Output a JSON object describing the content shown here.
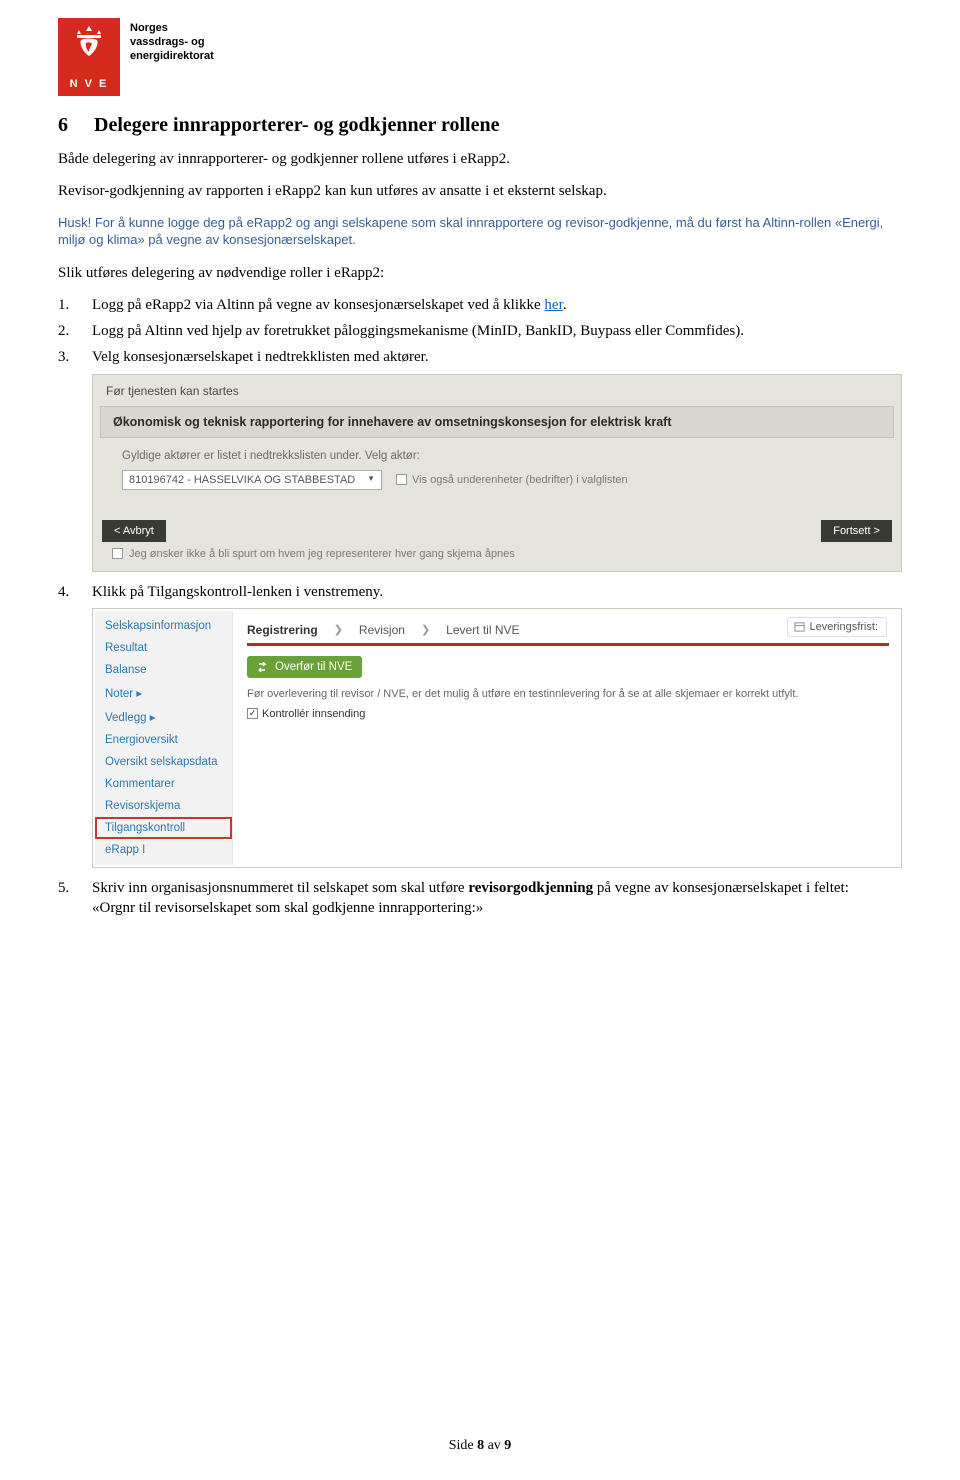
{
  "logo": {
    "org1": "Norges",
    "org2": "vassdrags- og",
    "org3": "energidirektorat",
    "abbr_letters": "N   V   E"
  },
  "section": {
    "number": "6",
    "title": "Delegere innrapporterer- og godkjenner rollene"
  },
  "intro1": "Både delegering av innrapporterer- og godkjenner rollene utføres i eRapp2.",
  "intro2": "Revisor-godkjenning av rapporten i eRapp2 kan kun utføres av ansatte i et eksternt selskap.",
  "husk_label": "Husk!",
  "husk_text": " For å kunne logge deg på eRapp2 og angi selskapene som skal innrapportere og revisor-godkjenne, må du først ha Altinn-rollen «Energi, miljø og klima» på vegne av konsesjonærselskapet.",
  "lead": "Slik utføres delegering av nødvendige roller i eRapp2:",
  "steps": {
    "s1a": "Logg på eRapp2 via Altinn på vegne av konsesjonærselskapet ved å klikke ",
    "s1_link": "her",
    "s1b": ".",
    "s2": "Logg på Altinn ved hjelp av foretrukket påloggingsmekanisme (MinID, BankID, Buypass eller Commfides).",
    "s3": "Velg konsesjonærselskapet i nedtrekklisten med aktører.",
    "s4": "Klikk på Tilgangskontroll-lenken i venstremeny.",
    "s5a": "Skriv inn organisasjonsnummeret til selskapet som skal utføre ",
    "s5b": "revisorgodkjenning",
    "s5c": " på vegne av konsesjonærselskapet i feltet:",
    "s5d": "«Orgnr til revisorselskapet som skal godkjenne innrapportering:»"
  },
  "altinn": {
    "preTitle": "Før tjenesten kan startes",
    "header": "Økonomisk og teknisk rapportering for innehavere av omsetningskonsesjon for elektrisk kraft",
    "listLabel": "Gyldige aktører er listet i nedtrekkslisten under. Velg aktør:",
    "selectValue": "810196742 - HASSELVIKA OG STABBESTAD",
    "showSub": "Vis også underenheter (bedrifter) i valglisten",
    "cancel": "< Avbryt",
    "continue": "Fortsett >",
    "dontAsk": "Jeg ønsker ikke å bli spurt om hvem jeg representerer hver gang skjema åpnes"
  },
  "erapp": {
    "menu": [
      "Selskapsinformasjon",
      "Resultat",
      "Balanse",
      "Noter ▸",
      "Vedlegg ▸",
      "Energioversikt",
      "Oversikt selskapsdata",
      "Kommentarer",
      "Revisorskjema",
      "Tilgangskontroll",
      "eRapp I"
    ],
    "crumbs": {
      "c1": "Registrering",
      "c2": "Revisjon",
      "c3": "Levert til NVE"
    },
    "deadline": "Leveringsfrist:",
    "transfer": "Overfør til NVE",
    "infoText": "Før overlevering til revisor / NVE, er det mulig å utføre en testinnlevering for å se at alle skjemaer er korrekt utfylt.",
    "controlLabel": "Kontrollér innsending",
    "checkMark": "✓"
  },
  "footer": {
    "a": "Side ",
    "b": "8",
    "c": " av ",
    "d": "9"
  }
}
